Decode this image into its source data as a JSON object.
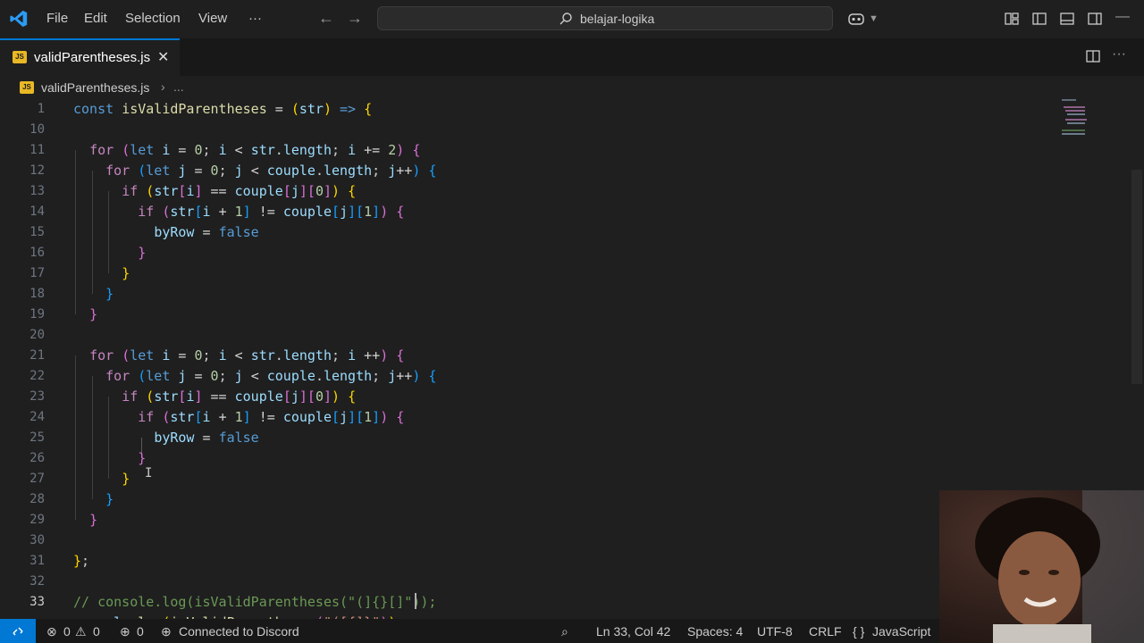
{
  "menu": [
    "File",
    "Edit",
    "Selection",
    "View",
    "···"
  ],
  "search": {
    "text": "belajar-logika"
  },
  "tab": {
    "badge": "JS",
    "label": "validParentheses.js"
  },
  "breadcrumb": {
    "file": "validParentheses.js",
    "sep": "›",
    "more": "..."
  },
  "lines": [
    {
      "n": "1",
      "html": "<span class='kw'>const</span> <span class='fn'>isValidParentheses</span> <span class='op'>=</span> <span class='br1'>(</span><span class='var'>str</span><span class='br1'>)</span> <span class='kw'>=&gt;</span> <span class='br1'>{</span>"
    },
    {
      "n": "10",
      "html": ""
    },
    {
      "n": "11",
      "html": "  <span class='kw2'>for</span> <span class='br2'>(</span><span class='kw'>let</span> <span class='var'>i</span> <span class='op'>=</span> <span class='num'>0</span>; <span class='var'>i</span> <span class='op'>&lt;</span> <span class='var'>str</span>.<span class='var'>length</span>; <span class='var'>i</span> <span class='op'>+=</span> <span class='num'>2</span><span class='br2'>)</span> <span class='br2'>{</span>"
    },
    {
      "n": "12",
      "html": "    <span class='kw2'>for</span> <span class='br3'>(</span><span class='kw'>let</span> <span class='var'>j</span> <span class='op'>=</span> <span class='num'>0</span>; <span class='var'>j</span> <span class='op'>&lt;</span> <span class='var'>couple</span>.<span class='var'>length</span>; <span class='var'>j</span><span class='op'>++</span><span class='br3'>)</span> <span class='br3'>{</span>"
    },
    {
      "n": "13",
      "html": "      <span class='kw2'>if</span> <span class='br1'>(</span><span class='var'>str</span><span class='br2'>[</span><span class='var'>i</span><span class='br2'>]</span> <span class='op'>==</span> <span class='var'>couple</span><span class='br2'>[</span><span class='var'>j</span><span class='br2'>][</span><span class='num'>0</span><span class='br2'>]</span><span class='br1'>)</span> <span class='br1'>{</span>"
    },
    {
      "n": "14",
      "html": "        <span class='kw2'>if</span> <span class='br2'>(</span><span class='var'>str</span><span class='br3'>[</span><span class='var'>i</span> <span class='op'>+</span> <span class='num'>1</span><span class='br3'>]</span> <span class='op'>!=</span> <span class='var'>couple</span><span class='br3'>[</span><span class='var'>j</span><span class='br3'>][</span><span class='num'>1</span><span class='br3'>]</span><span class='br2'>)</span> <span class='br2'>{</span>"
    },
    {
      "n": "15",
      "html": "          <span class='var'>byRow</span> <span class='op'>=</span> <span class='kw'>false</span>"
    },
    {
      "n": "16",
      "html": "        <span class='br2'>}</span>"
    },
    {
      "n": "17",
      "html": "      <span class='br1'>}</span>"
    },
    {
      "n": "18",
      "html": "    <span class='br3'>}</span>"
    },
    {
      "n": "19",
      "html": "  <span class='br2'>}</span>"
    },
    {
      "n": "20",
      "html": ""
    },
    {
      "n": "21",
      "html": "  <span class='kw2'>for</span> <span class='br2'>(</span><span class='kw'>let</span> <span class='var'>i</span> <span class='op'>=</span> <span class='num'>0</span>; <span class='var'>i</span> <span class='op'>&lt;</span> <span class='var'>str</span>.<span class='var'>length</span>; <span class='var'>i</span> <span class='op'>++</span><span class='br2'>)</span> <span class='br2'>{</span>"
    },
    {
      "n": "22",
      "html": "    <span class='kw2'>for</span> <span class='br3'>(</span><span class='kw'>let</span> <span class='var'>j</span> <span class='op'>=</span> <span class='num'>0</span>; <span class='var'>j</span> <span class='op'>&lt;</span> <span class='var'>couple</span>.<span class='var'>length</span>; <span class='var'>j</span><span class='op'>++</span><span class='br3'>)</span> <span class='br3'>{</span>"
    },
    {
      "n": "23",
      "html": "      <span class='kw2'>if</span> <span class='br1'>(</span><span class='var'>str</span><span class='br2'>[</span><span class='var'>i</span><span class='br2'>]</span> <span class='op'>==</span> <span class='var'>couple</span><span class='br2'>[</span><span class='var'>j</span><span class='br2'>][</span><span class='num'>0</span><span class='br2'>]</span><span class='br1'>)</span> <span class='br1'>{</span>"
    },
    {
      "n": "24",
      "html": "        <span class='kw2'>if</span> <span class='br2'>(</span><span class='var'>str</span><span class='br3'>[</span><span class='var'>i</span> <span class='op'>+</span> <span class='num'>1</span><span class='br3'>]</span> <span class='op'>!=</span> <span class='var'>couple</span><span class='br3'>[</span><span class='var'>j</span><span class='br3'>][</span><span class='num'>1</span><span class='br3'>]</span><span class='br2'>)</span> <span class='br2'>{</span>"
    },
    {
      "n": "25",
      "html": "          <span class='var'>byRow</span> <span class='op'>=</span> <span class='kw'>false</span>"
    },
    {
      "n": "26",
      "html": "        <span class='br2'>}</span>"
    },
    {
      "n": "27",
      "html": "      <span class='br1'>}</span>"
    },
    {
      "n": "28",
      "html": "    <span class='br3'>}</span>"
    },
    {
      "n": "29",
      "html": "  <span class='br2'>}</span>"
    },
    {
      "n": "30",
      "html": ""
    },
    {
      "n": "31",
      "html": "<span class='br1'>}</span>;"
    },
    {
      "n": "32",
      "html": ""
    },
    {
      "n": "33",
      "html": "<span class='cm'>// console.log(isValidParentheses(\"(]{}[]\"));</span>"
    },
    {
      "n": "",
      "html": "<span class='var'>console</span>.<span class='fn'>log</span><span class='br1'>(</span><span class='fn'>isValidParentheses</span><span class='br2'>(</span><span class='str'>\"([{]}\"</span><span class='br2'>)</span><span class='br1'>)</span>;"
    }
  ],
  "status": {
    "errors": "0",
    "warnings": "0",
    "ports": "0",
    "discord": "Connected to Discord",
    "position": "Ln 33, Col 42",
    "spaces": "Spaces: 4",
    "encoding": "UTF-8",
    "eol": "CRLF",
    "language_icon": "{ }",
    "language": "JavaScript"
  },
  "colors": {
    "accent": "#0078d4",
    "editor_bg": "#1f1f1f",
    "js_badge": "#e9b825"
  }
}
